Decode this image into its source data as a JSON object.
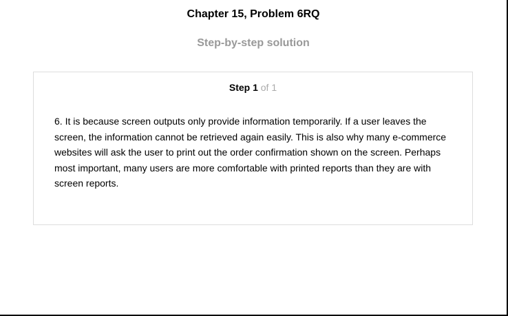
{
  "header": {
    "title": "Chapter 15, Problem 6RQ",
    "subtitle": "Step-by-step solution"
  },
  "step": {
    "label": "Step 1",
    "of_text": "of 1",
    "body": "6. It is because screen outputs only provide information temporarily. If a user leaves the screen, the information cannot be retrieved again easily. This is also why many e-commerce websites will ask the user to print out the order confirmation shown on the screen. Perhaps most important, many users are more comfortable with printed reports than they are with screen reports."
  }
}
